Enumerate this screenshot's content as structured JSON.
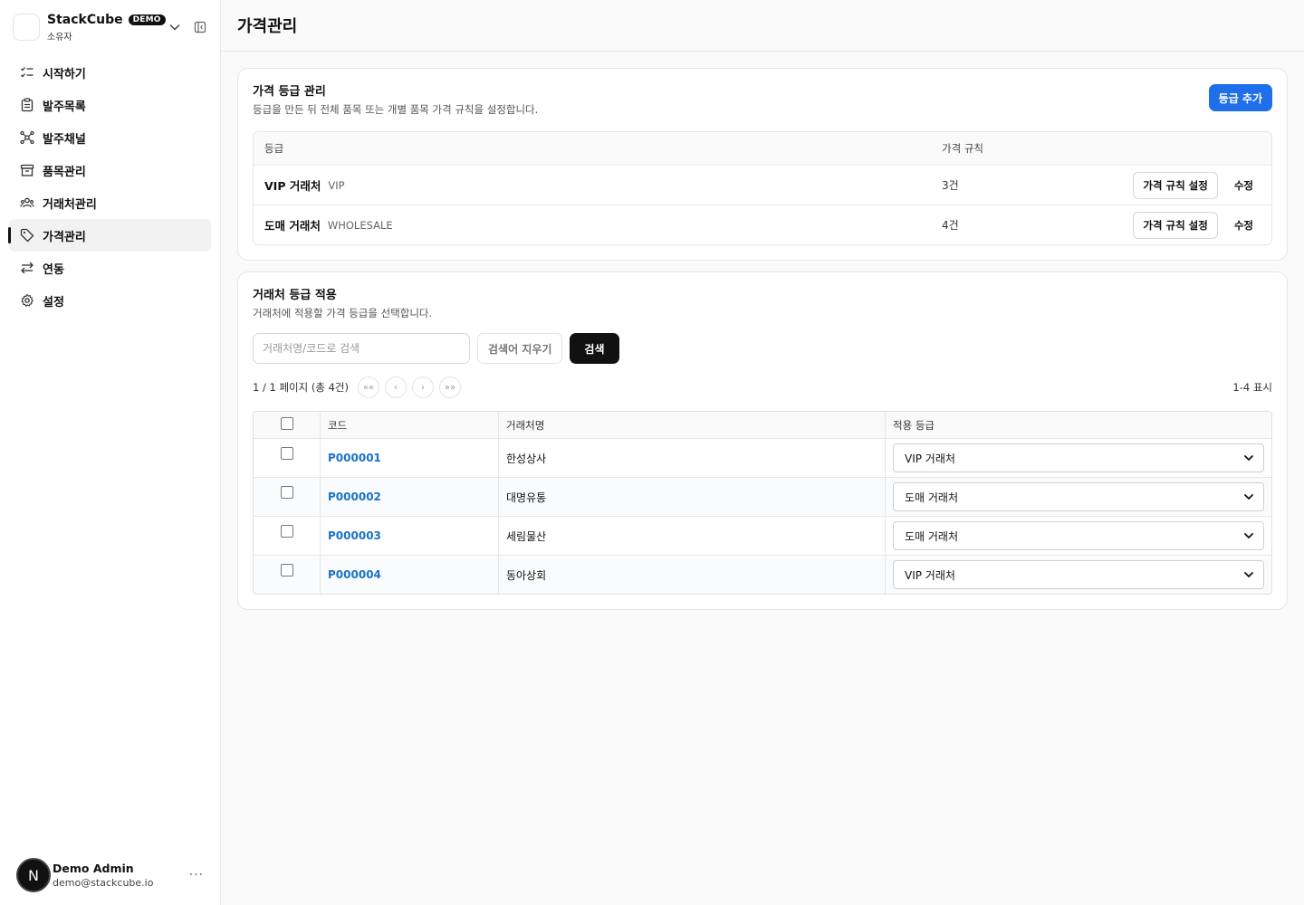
{
  "brand": {
    "name": "StackCube",
    "badge": "DEMO",
    "role": "소유자"
  },
  "nav": {
    "items": [
      {
        "label": "시작하기",
        "icon": "checklist-icon"
      },
      {
        "label": "발주목록",
        "icon": "clipboard-icon"
      },
      {
        "label": "발주채널",
        "icon": "network-icon"
      },
      {
        "label": "품목관리",
        "icon": "archive-box-icon"
      },
      {
        "label": "거래처관리",
        "icon": "users-icon"
      },
      {
        "label": "가격관리",
        "icon": "tag-icon",
        "active": true
      },
      {
        "label": "연동",
        "icon": "arrows-exchange-icon"
      },
      {
        "label": "설정",
        "icon": "gear-icon"
      }
    ]
  },
  "user": {
    "avatar_letter": "N",
    "name": "Demo Admin",
    "email": "demo@stackcube.io",
    "more": "···"
  },
  "page": {
    "title": "가격관리"
  },
  "grade_card": {
    "title": "가격 등급 관리",
    "desc": "등급을 만든 뒤 전체 품목 또는 개별 품목 가격 규칙을 설정합니다.",
    "add_button": "등급 추가",
    "columns": [
      "등급",
      "가격 규칙"
    ],
    "rows": [
      {
        "name": "VIP 거래처",
        "code": "VIP",
        "rules": "3건",
        "rule_button": "가격 규칙 설정",
        "edit_button": "수정"
      },
      {
        "name": "도매 거래처",
        "code": "WHOLESALE",
        "rules": "4건",
        "rule_button": "가격 규칙 설정",
        "edit_button": "수정"
      }
    ]
  },
  "apply_card": {
    "title": "거래처 등급 적용",
    "desc": "거래처에 적용할 가격 등급을 선택합니다.",
    "search_placeholder": "거래처명/코드로 검색",
    "clear_button": "검색어 지우기",
    "search_button": "검색",
    "pager": {
      "info": "1 / 1 페이지 (총 4건)",
      "first": "««",
      "prev": "‹",
      "next": "›",
      "last": "»»",
      "range": "1-4 표시"
    },
    "columns": [
      "코드",
      "거래처명",
      "적용 등급"
    ],
    "rows": [
      {
        "code": "P000001",
        "name": "한성상사",
        "grade": "VIP 거래처"
      },
      {
        "code": "P000002",
        "name": "대명유통",
        "grade": "도매 거래처"
      },
      {
        "code": "P000003",
        "name": "세림물산",
        "grade": "도매 거래처"
      },
      {
        "code": "P000004",
        "name": "동아상회",
        "grade": "VIP 거래처"
      }
    ]
  },
  "colors": {
    "primary": "#1f6feb",
    "link": "#1a73c7",
    "dark": "#111111"
  }
}
